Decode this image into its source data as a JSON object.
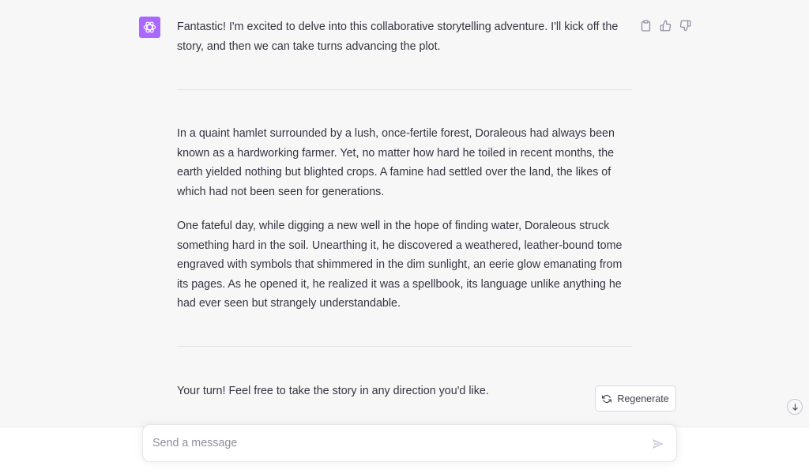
{
  "conversation": {
    "assistant_avatar_icon": "openai-logo-icon",
    "avatar_color": "#ab68ff",
    "message_actions": {
      "copy_icon": "clipboard-icon",
      "like_icon": "thumbs-up-icon",
      "dislike_icon": "thumbs-down-icon"
    },
    "intro": "Fantastic! I'm excited to delve into this collaborative storytelling adventure. I'll kick off the story, and then we can take turns advancing the plot.",
    "paragraph_1": "In a quaint hamlet surrounded by a lush, once-fertile forest, Doraleous had always been known as a hardworking farmer. Yet, no matter how hard he toiled in recent months, the earth yielded nothing but blighted crops. A famine had settled over the land, the likes of which had not been seen for generations.",
    "paragraph_2": "One fateful day, while digging a new well in the hope of finding water, Doraleous struck something hard in the soil. Unearthing it, he discovered a weathered, leather-bound tome engraved with symbols that shimmered in the dim sunlight, an eerie glow emanating from its pages. As he opened it, he realized it was a spellbook, its language unlike anything he had ever seen but strangely understandable.",
    "closing": "Your turn! Feel free to take the story in any direction you'd like."
  },
  "controls": {
    "regenerate_label": "Regenerate",
    "regenerate_icon": "refresh-icon",
    "scroll_down_icon": "arrow-down-icon"
  },
  "composer": {
    "placeholder": "Send a message",
    "value": "",
    "send_icon": "paper-plane-icon"
  }
}
